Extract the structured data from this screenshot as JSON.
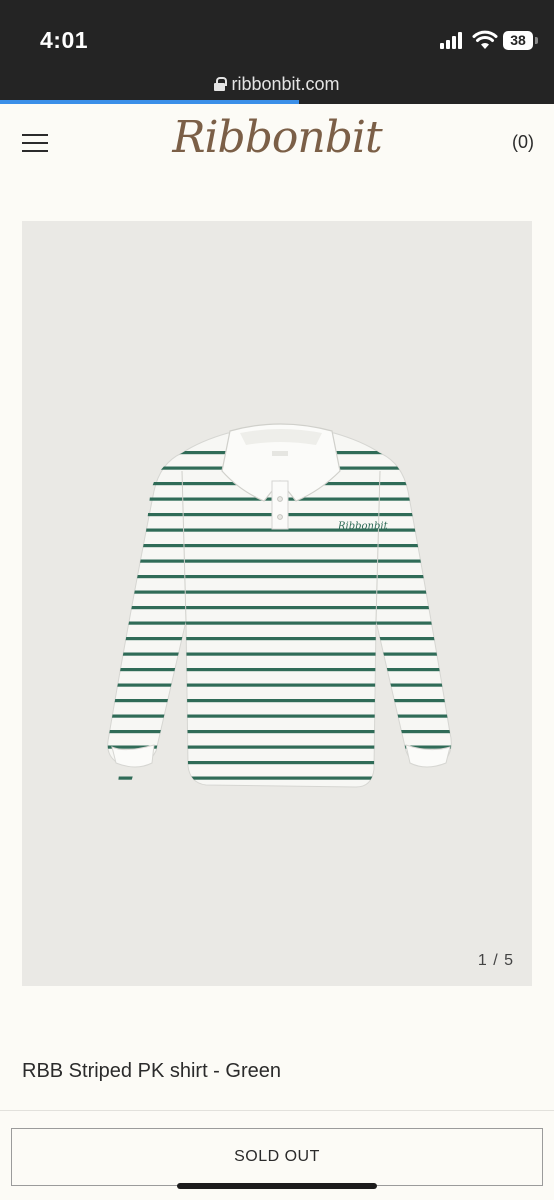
{
  "status_bar": {
    "time": "4:01",
    "battery": "38",
    "url": "ribbonbit.com",
    "load_progress": 0.54
  },
  "header": {
    "logo": "Ribbonbit",
    "cart": "(0)"
  },
  "gallery": {
    "counter": "1 / 5",
    "shirt_colors": {
      "stripe": "#2f6b57",
      "body": "#f7f7f4",
      "collar": "#fbfbf9"
    },
    "embroidery": "Ribbonbit"
  },
  "product": {
    "title": "RBB Striped PK shirt - Green"
  },
  "actions": {
    "sold_out": "SOLD OUT"
  },
  "icons": [
    "lock-icon",
    "signal-icon",
    "wifi-icon",
    "battery-icon",
    "menu-icon"
  ]
}
